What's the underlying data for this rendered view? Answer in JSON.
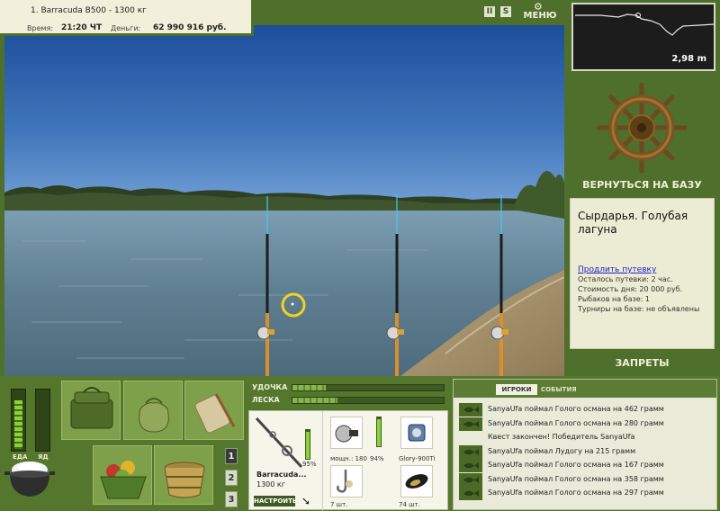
{
  "info_bar": {
    "rod_title": "1. Barracuda B500 - 1300 кг",
    "time_label": "Время:",
    "time_value": "21:20 ЧТ",
    "money_label": "Деньги:",
    "money_value": "62 990 916 руб."
  },
  "top_controls": {
    "pause_glyph": "II",
    "sound_glyph": "S",
    "menu_label": "МЕНЮ"
  },
  "depth": {
    "value": "2,98 m"
  },
  "base": {
    "return_label": "ВЕРНУТЬСЯ НА БАЗУ",
    "location_name": "Сырдарья. Голубая лагуна",
    "extend_link": "Продлить путевку",
    "lines": [
      "Осталось путевки: 2 час.",
      "Стоимость дня: 20 000 руб.",
      "Рыбаков на базе: 1",
      "Турниры на базе: не объявлены"
    ],
    "bans_label": "ЗАПРЕТЫ"
  },
  "meters": {
    "food_label": "ЕДА",
    "poison_label": "ЯД",
    "food_level": 0.85,
    "poison_level": 0.0
  },
  "inventory": {
    "pages": [
      "1",
      "2",
      "3"
    ],
    "active_page": "1"
  },
  "tackle": {
    "rod_label": "УДОЧКА",
    "line_label": "ЛЕСКА",
    "rod_tension": 0.22,
    "line_tension": 0.3,
    "rod_name": "Barracuda...",
    "rod_weight": "1300 кг",
    "rod_condition": "95%",
    "setup_label": "НАСТРОИТЬ",
    "reel_power": "мощн.: 180",
    "reel_condition": "94%",
    "line_name": "Glory-900Ti",
    "hook_count": "7 шт.",
    "bait_count": "74 шт."
  },
  "events": {
    "tab_players": "ИГРОКИ",
    "tab_events": "СОБЫТИЯ",
    "rows": [
      {
        "text": "SanyaUfa поймал Голого османа на 462 грамм",
        "icon": true
      },
      {
        "text": "SanyaUfa поймал Голого османа на 280 грамм",
        "icon": true
      },
      {
        "text": "Квест закончен! Победитель SanyaUfa",
        "icon": false
      },
      {
        "text": "SanyaUfa поймал Лудогу на 215 грамм",
        "icon": true
      },
      {
        "text": "SanyaUfa поймал Голого османа на 167 грамм",
        "icon": true
      },
      {
        "text": "SanyaUfa поймал Голого османа на 358 грамм",
        "icon": true
      },
      {
        "text": "SanyaUfa поймал Голого османа на 297 грамм",
        "icon": true
      }
    ]
  }
}
